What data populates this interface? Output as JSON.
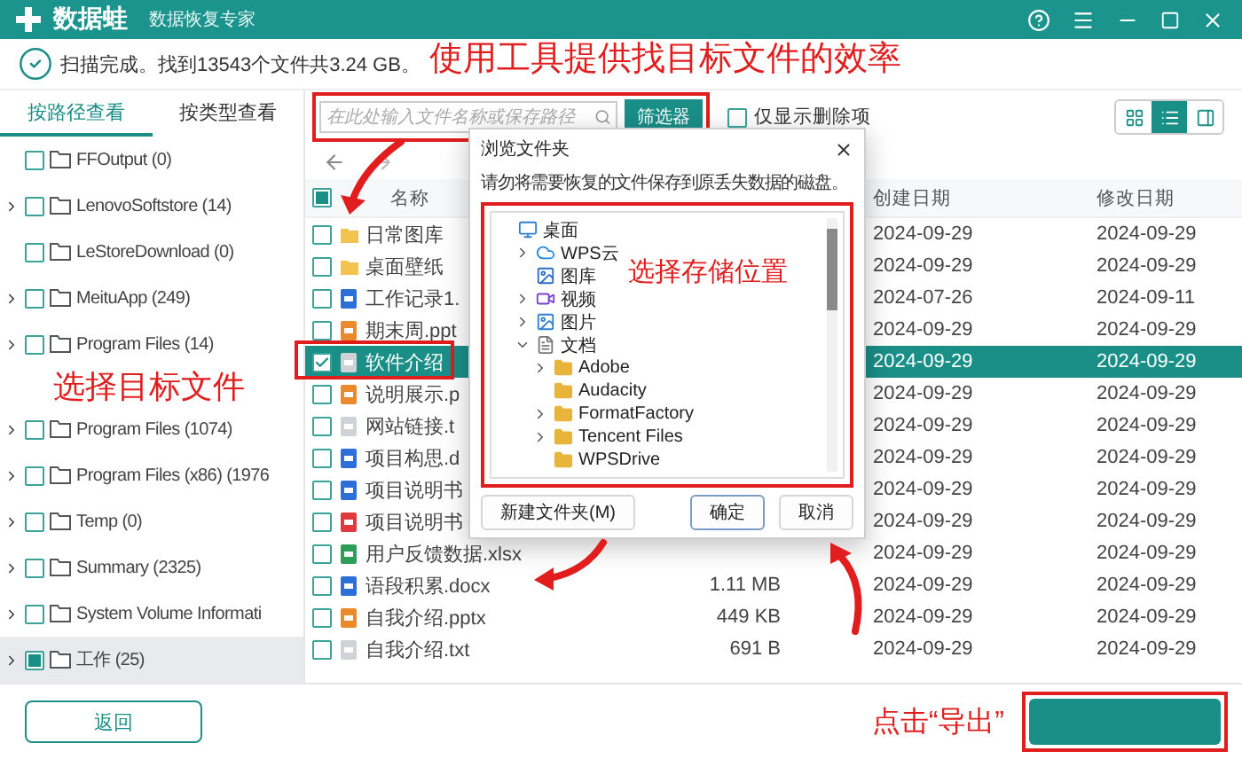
{
  "app": {
    "name": "数据蛙",
    "subtitle": "数据恢复专家"
  },
  "status": "扫描完成。找到13543个文件共3.24 GB。",
  "view_tabs": [
    {
      "label": "按路径查看",
      "selected": true
    },
    {
      "label": "按类型查看",
      "selected": false
    }
  ],
  "folder_tree": [
    {
      "label": "FFOutput (0)",
      "checked": false,
      "selected": false
    },
    {
      "label": "LenovoSoftstore (14)",
      "expanded": false,
      "checked": false,
      "selected": false
    },
    {
      "label": "LeStoreDownload (0)",
      "checked": false,
      "selected": false
    },
    {
      "label": "MeituApp (249)",
      "expanded": false,
      "checked": false,
      "selected": false
    },
    {
      "label": "Program Files (14)",
      "expanded": false,
      "checked": false,
      "selected": false
    },
    {
      "label": "Program Files (1074)",
      "expanded": false,
      "checked": false,
      "selected": false
    },
    {
      "label": "Program Files (x86) (1976",
      "expanded": false,
      "checked": false,
      "selected": false
    },
    {
      "label": "Temp (0)",
      "expanded": false,
      "checked": false,
      "selected": false
    },
    {
      "label": "Summary (2325)",
      "expanded": false,
      "checked": false,
      "selected": false
    },
    {
      "label": "System Volume Informati",
      "expanded": false,
      "checked": false,
      "selected": false
    },
    {
      "label": "工作 (25)",
      "expanded": false,
      "checked": true,
      "selected": true
    }
  ],
  "search": {
    "placeholder": "在此处输入文件名称或保存路径"
  },
  "filter_button": "筛选器",
  "deleted_only": {
    "label": "仅显示删除项",
    "checked": false
  },
  "view_modes": [
    {
      "kind": "grid",
      "selected": false
    },
    {
      "kind": "list",
      "selected": true
    },
    {
      "kind": "panel",
      "selected": false
    }
  ],
  "table": {
    "select_all_checked": true,
    "columns": {
      "name": "名称",
      "created": "创建日期",
      "modified": "修改日期"
    },
    "rows": [
      {
        "name": "日常图库",
        "kind": "folder",
        "created": "2024-09-29",
        "modified": "2024-09-29",
        "checked": false,
        "selected": false
      },
      {
        "name": "桌面壁纸",
        "kind": "folder",
        "created": "2024-09-29",
        "modified": "2024-09-29",
        "checked": false,
        "selected": false
      },
      {
        "name": "工作记录1.",
        "kind": "word",
        "created": "2024-07-26",
        "modified": "2024-09-11",
        "checked": false,
        "selected": false
      },
      {
        "name": "期末周.ppt",
        "kind": "ppt",
        "created": "2024-09-29",
        "modified": "2024-09-29",
        "checked": false,
        "selected": false
      },
      {
        "name": "软件介绍",
        "kind": "txt",
        "created": "2024-09-29",
        "modified": "2024-09-29",
        "checked": true,
        "selected": true
      },
      {
        "name": "说明展示.p",
        "kind": "ppt",
        "created": "2024-09-29",
        "modified": "2024-09-29",
        "checked": false,
        "selected": false
      },
      {
        "name": "网站链接.t",
        "kind": "txt",
        "created": "2024-09-29",
        "modified": "2024-09-29",
        "checked": false,
        "selected": false
      },
      {
        "name": "项目构思.d",
        "kind": "word",
        "created": "2024-09-29",
        "modified": "2024-09-29",
        "checked": false,
        "selected": false
      },
      {
        "name": "项目说明书",
        "kind": "word",
        "created": "2024-09-29",
        "modified": "2024-09-29",
        "checked": false,
        "selected": false
      },
      {
        "name": "项目说明书",
        "kind": "pdf",
        "created": "2024-09-29",
        "modified": "2024-09-29",
        "checked": false,
        "selected": false
      },
      {
        "name": "用户反馈数据.xlsx",
        "kind": "excel",
        "created": "2024-09-29",
        "modified": "2024-09-29",
        "checked": false,
        "selected": false
      },
      {
        "name": "语段积累.docx",
        "kind": "word",
        "size": "1.11 MB",
        "created": "2024-09-29",
        "modified": "2024-09-29",
        "checked": false,
        "selected": false
      },
      {
        "name": "自我介绍.pptx",
        "kind": "ppt",
        "size": "449 KB",
        "created": "2024-09-29",
        "modified": "2024-09-29",
        "checked": false,
        "selected": false
      },
      {
        "name": "自我介绍.txt",
        "kind": "txt",
        "size": "691 B",
        "created": "2024-09-29",
        "modified": "2024-09-29",
        "checked": false,
        "selected": false
      }
    ]
  },
  "dialog": {
    "title": "浏览文件夹",
    "message": "请勿将需要恢复的文件保存到原丢失数据的磁盘。",
    "tree": [
      {
        "label": "桌面",
        "kind": "desktop",
        "children": [
          {
            "label": "WPS云",
            "kind": "cloud",
            "expanded": false
          },
          {
            "label": "图库",
            "kind": "gallery"
          },
          {
            "label": "视频",
            "kind": "video",
            "expanded": false
          },
          {
            "label": "图片",
            "kind": "pictures",
            "expanded": false
          },
          {
            "label": "文档",
            "kind": "documents",
            "expanded": true,
            "children": [
              {
                "label": "Adobe",
                "kind": "folder",
                "expanded": false
              },
              {
                "label": "Audacity",
                "kind": "folder"
              },
              {
                "label": "FormatFactory",
                "kind": "folder",
                "expanded": false
              },
              {
                "label": "Tencent Files",
                "kind": "folder",
                "expanded": false
              },
              {
                "label": "WPSDrive",
                "kind": "folder"
              }
            ]
          }
        ]
      }
    ],
    "buttons": [
      "新建文件夹(M)",
      "确定",
      "取消"
    ]
  },
  "annotations": [
    "使用工具提供找目标文件的效率",
    "选择目标文件",
    "选择存储位置",
    "点击“导出”"
  ],
  "back_button": "返回"
}
